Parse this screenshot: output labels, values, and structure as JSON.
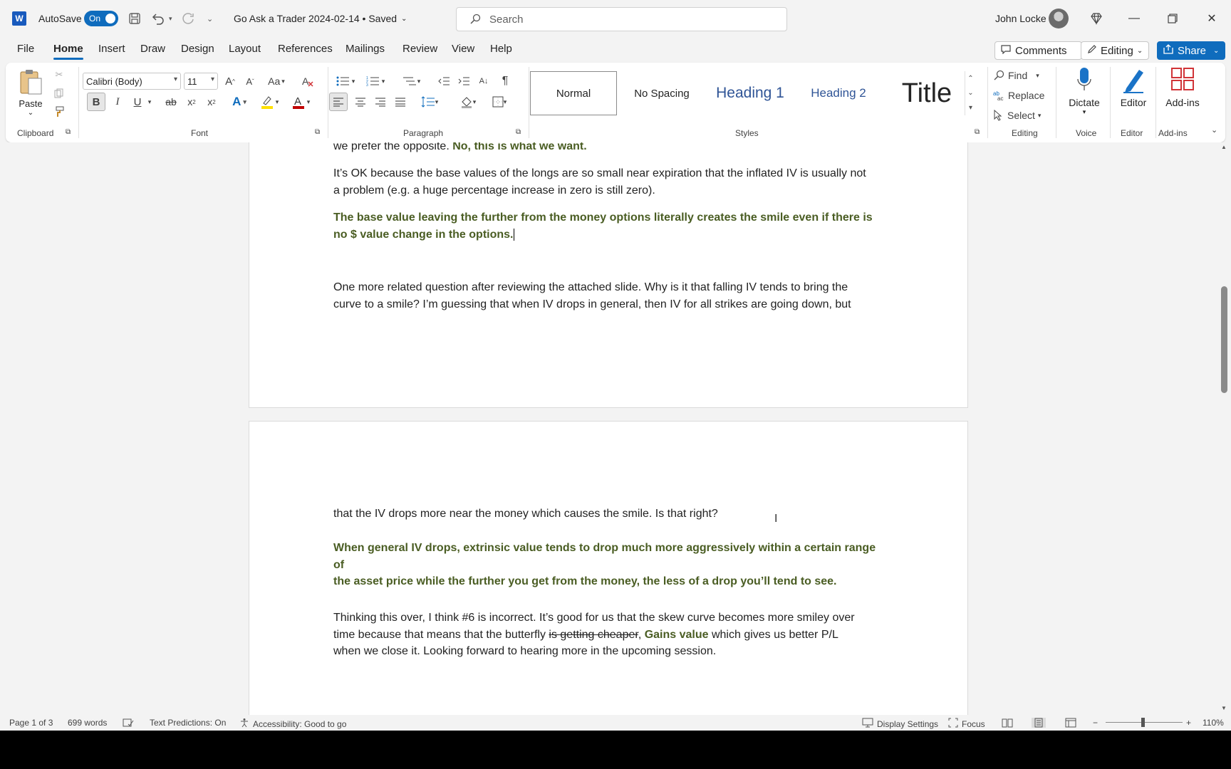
{
  "titlebar": {
    "app_logo": "W",
    "autosave_label": "AutoSave",
    "autosave_state": "On",
    "doc_title": "Go Ask a Trader 2024-02-14 • Saved",
    "search_placeholder": "Search",
    "user_name": "John Locke"
  },
  "tabs": [
    "File",
    "Home",
    "Insert",
    "Draw",
    "Design",
    "Layout",
    "References",
    "Mailings",
    "Review",
    "View",
    "Help"
  ],
  "right_buttons": {
    "comments": "Comments",
    "editing": "Editing",
    "share": "Share"
  },
  "ribbon": {
    "clipboard": {
      "paste": "Paste",
      "label": "Clipboard"
    },
    "font": {
      "name": "Calibri (Body)",
      "size": "11",
      "label": "Font"
    },
    "paragraph": {
      "label": "Paragraph"
    },
    "styles": {
      "label": "Styles",
      "items": [
        "Normal",
        "No Spacing",
        "Heading 1",
        "Heading 2",
        "Title"
      ]
    },
    "editing": {
      "find": "Find",
      "replace": "Replace",
      "select": "Select",
      "label": "Editing"
    },
    "voice": {
      "dictate": "Dictate",
      "label": "Voice"
    },
    "editor": {
      "editor": "Editor",
      "label": "Editor"
    },
    "addins": {
      "addins": "Add-ins",
      "label": "Add-ins"
    }
  },
  "document": {
    "p1_plain": "we prefer the opposite. ",
    "p1_bold": "No, this is what we want.",
    "p2_line1": "It’s OK because the base values of the longs are so small near expiration that the inflated IV is usually not",
    "p2_line2": "a problem (e.g. a huge percentage increase in zero is still zero).",
    "p3_line1": "The base value leaving the further from the money options literally creates the smile even if there is",
    "p3_line2": "no $ value change in the options.",
    "p4_line1": "One more related question after reviewing the attached slide. Why is it that falling IV tends to bring the",
    "p4_line2": "curve to a smile? I’m guessing that when IV drops in general, then IV for all strikes are going down, but",
    "p5": "that the IV drops more near the money which causes the smile. Is that right?",
    "p6_line1": "When general IV drops, extrinsic value tends to drop much more aggressively within a certain range of",
    "p6_line2": "the asset price while the further you get from the money, the less of a drop you’ll tend to see.",
    "p7_line1": "Thinking this over, I think #6 is incorrect. It’s good for us that the skew curve becomes more smiley over",
    "p7_line2a": "time because that means that the butterfly ",
    "p7_line2_strike": "is getting cheaper",
    "p7_line2_comma": ", ",
    "p7_line2_bold": "Gains value",
    "p7_line2b": " which gives us better P/L",
    "p7_line3": "when we close it. Looking forward to hearing more in the upcoming session."
  },
  "statusbar": {
    "page": "Page 1 of 3",
    "words": "699 words",
    "text_predictions": "Text Predictions: On",
    "accessibility": "Accessibility: Good to go",
    "display_settings": "Display Settings",
    "focus": "Focus",
    "zoom": "110%"
  },
  "colors": {
    "accent": "#0f6cbd",
    "answer_text": "#4a5d23"
  }
}
